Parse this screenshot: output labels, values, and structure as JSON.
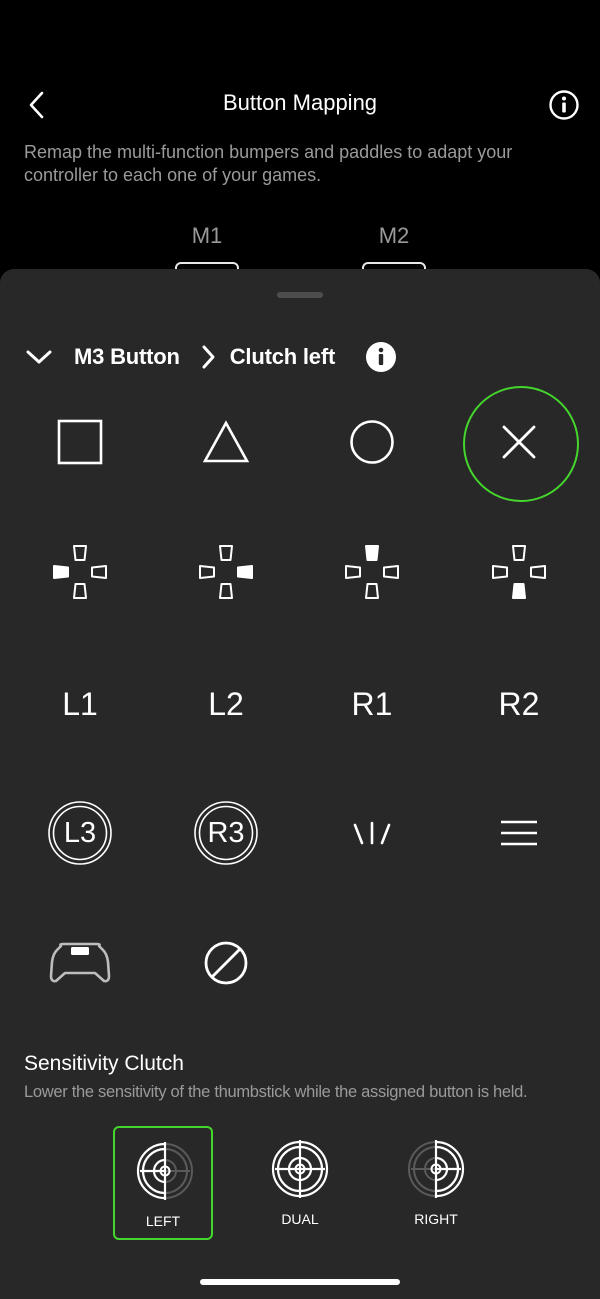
{
  "header": {
    "title": "Button Mapping",
    "description": "Remap the multi-function bumpers and paddles to adapt your controller to each one of your games.",
    "m1_label": "M1",
    "m2_label": "M2"
  },
  "breadcrumb": {
    "parent": "M3 Button",
    "current": "Clutch left"
  },
  "buttons": {
    "l1": "L1",
    "l2": "L2",
    "r1": "R1",
    "r2": "R2",
    "l3": "L3",
    "r3": "R3",
    "selected": "cross",
    "accent_color": "#44d62c"
  },
  "sensitivity": {
    "title": "Sensitivity Clutch",
    "description": "Lower the sensitivity of the thumbstick while the assigned button is held.",
    "options": [
      "LEFT",
      "DUAL",
      "RIGHT"
    ],
    "selected": "LEFT"
  }
}
